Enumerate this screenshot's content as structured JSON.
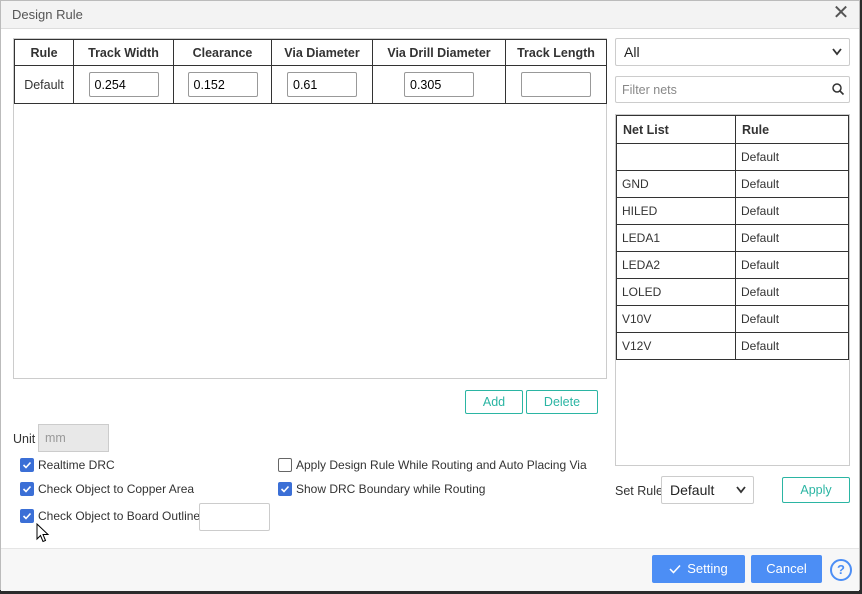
{
  "window": {
    "title": "Design Rule"
  },
  "rules_table": {
    "headers": [
      "Rule",
      "Track Width",
      "Clearance",
      "Via Diameter",
      "Via Drill Diameter",
      "Track Length"
    ],
    "rows": [
      {
        "rule": "Default",
        "track_width": "0.254",
        "clearance": "0.152",
        "via_diameter": "0.61",
        "via_drill": "0.305",
        "track_length": ""
      }
    ]
  },
  "buttons": {
    "add": "Add",
    "delete": "Delete",
    "setting": "Setting",
    "cancel": "Cancel",
    "apply": "Apply"
  },
  "net_filter": {
    "selected": "All",
    "placeholder": "Filter nets"
  },
  "net_table": {
    "headers": [
      "Net List",
      "Rule"
    ],
    "rows": [
      {
        "net": "",
        "rule": "Default"
      },
      {
        "net": "GND",
        "rule": "Default"
      },
      {
        "net": "HILED",
        "rule": "Default"
      },
      {
        "net": "LEDA1",
        "rule": "Default"
      },
      {
        "net": "LEDA2",
        "rule": "Default"
      },
      {
        "net": "LOLED",
        "rule": "Default"
      },
      {
        "net": "V10V",
        "rule": "Default"
      },
      {
        "net": "V12V",
        "rule": "Default"
      }
    ]
  },
  "unit": {
    "label": "Unit",
    "value": "mm"
  },
  "checkboxes": [
    {
      "label": "Realtime DRC",
      "checked": true
    },
    {
      "label": "Check Object to Copper Area",
      "checked": true
    },
    {
      "label": "Check Object to Board Outline",
      "checked": true
    },
    {
      "label": "Apply Design Rule While Routing and Auto Placing Via",
      "checked": false
    },
    {
      "label": "Show DRC Boundary while Routing",
      "checked": true
    }
  ],
  "set_rule": {
    "label": "Set Rule",
    "selected": "Default"
  },
  "help_glyph": "?",
  "close_glyph": "✕",
  "colors": {
    "accent": "#4c8ef5",
    "teal": "#2bb5a3",
    "checkbox": "#3b6fd6"
  }
}
